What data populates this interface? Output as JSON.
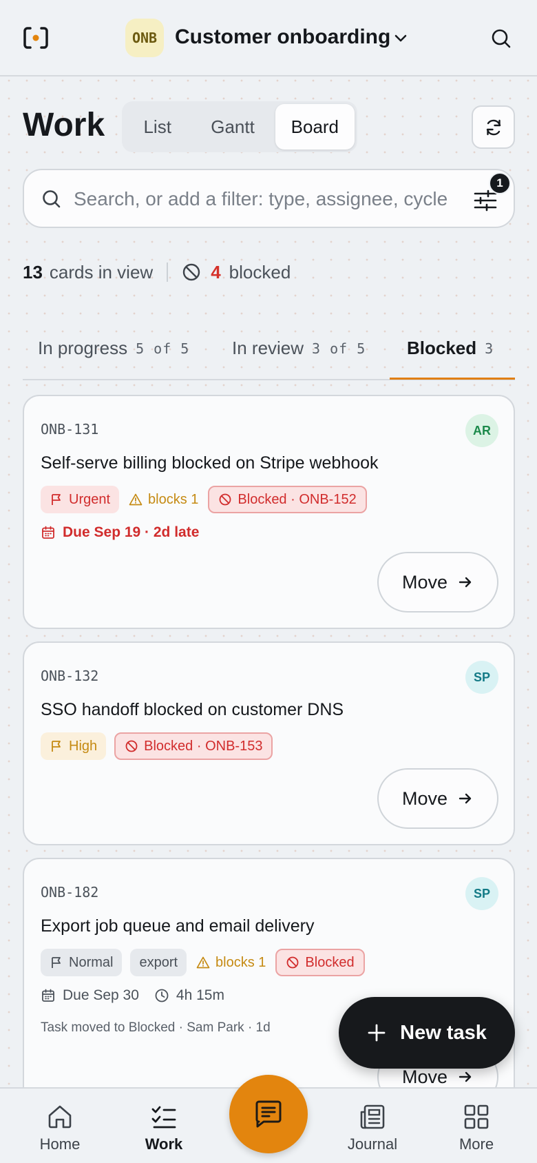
{
  "workspace": {
    "badge": "ONB",
    "title": "Customer onboarding"
  },
  "page": {
    "title": "Work"
  },
  "views": [
    {
      "label": "List",
      "active": false
    },
    {
      "label": "Gantt",
      "active": false
    },
    {
      "label": "Board",
      "active": true
    }
  ],
  "search": {
    "placeholder": "Search, or add a filter: type, assignee, cycle",
    "filter_count": "1"
  },
  "stats": {
    "cards": "13",
    "cards_label": "cards in view",
    "blocked": "4",
    "blocked_label": "blocked"
  },
  "tabs": [
    {
      "label": "In progress",
      "count": "5 of 5",
      "active": false
    },
    {
      "label": "In review",
      "count": "3 of 5",
      "active": false
    },
    {
      "label": "Blocked",
      "count": "3",
      "active": true
    }
  ],
  "cards": [
    {
      "id": "ONB-131",
      "assignee": "AR",
      "title": "Self-serve billing blocked on Stripe webhook",
      "priority": "Urgent",
      "blocks": "blocks 1",
      "blocked": "Blocked · ONB-152",
      "due": "Due Sep 19 · 2d late",
      "move": "Move"
    },
    {
      "id": "ONB-132",
      "assignee": "SP",
      "title": "SSO handoff blocked on customer DNS",
      "priority": "High",
      "blocked": "Blocked · ONB-153",
      "move": "Move"
    },
    {
      "id": "ONB-182",
      "assignee": "SP",
      "title": "Export job queue and email delivery",
      "priority": "Normal",
      "tag": "export",
      "blocks": "blocks 1",
      "blocked": "Blocked",
      "due": "Due Sep 30",
      "estimate": "4h 15m",
      "activity": "Task moved to Blocked · Sam Park · 1d",
      "move": "Move"
    }
  ],
  "fab": {
    "label": "New task"
  },
  "nav": [
    {
      "label": "Home",
      "icon": "home-icon",
      "active": false
    },
    {
      "label": "Work",
      "icon": "checklist-icon",
      "active": true
    },
    {
      "label": "Journal",
      "icon": "journal-icon",
      "active": false
    },
    {
      "label": "More",
      "icon": "grid-icon",
      "active": false
    }
  ],
  "colors": {
    "accent": "#e3850e",
    "danger": "#d12c2c",
    "warning": "#c58a12",
    "ink": "#16191d"
  }
}
